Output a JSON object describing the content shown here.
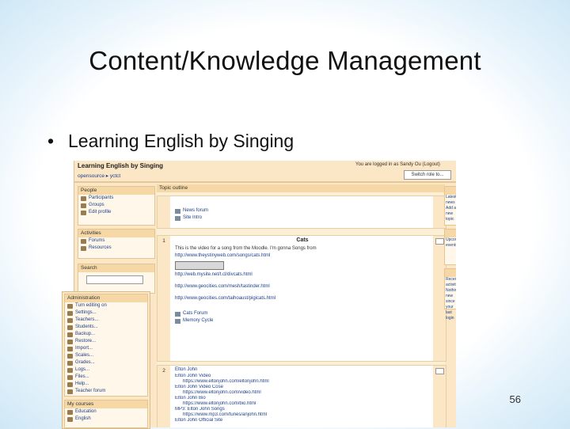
{
  "slide": {
    "title": "Content/Knowledge Management",
    "bullet": "Learning English by Singing",
    "page_number": "56"
  },
  "screenshot": {
    "course_title": "Learning English by Singing",
    "login_info": "You are logged in as Sandy Ou (Logout)",
    "breadcrumb": "opensource ▸ yctct",
    "role_button": "Switch role to...",
    "blocks": {
      "people": {
        "title": "People",
        "items": [
          "Participants",
          "Groups",
          "Edit profile"
        ]
      },
      "activities": {
        "title": "Activities",
        "items": [
          "Forums",
          "Resources"
        ]
      },
      "search": {
        "title": "Search"
      },
      "administration": {
        "title": "Administration",
        "items": [
          "Turn editing on",
          "Settings...",
          "Teachers...",
          "Students...",
          "Backup...",
          "Restore...",
          "Import...",
          "Scales...",
          "Grades...",
          "Logs...",
          "Files...",
          "Help...",
          "Teacher forum"
        ]
      },
      "my_courses": {
        "title": "My courses",
        "items": [
          "Education",
          "English"
        ]
      }
    },
    "center": {
      "header": "Topic outline",
      "top_items": [
        "News forum",
        "Site Intro"
      ],
      "topic1": {
        "number": "1",
        "title": "Cats",
        "lines": [
          "This is the video for a song from the Moodle. I'm gonna Songs from",
          "http://www.theystinyweb.com/songs/cats.html"
        ],
        "links": [
          "http://web.mysite.net/t.cl/divcats.html",
          "http://www.geocities.com/mesh/tastinder.html",
          "http://www.geocities.com/taihoaust/pigicats.html"
        ],
        "resources": [
          "Cats Forum",
          "Memory Cycle"
        ]
      },
      "topic2": {
        "number": "2",
        "lines": [
          "Elton John",
          "Elton John Video",
          "https://www.eltonjohn.com/eltonjohn.html",
          "Elton John Video Cose",
          "https://www.eltonjohn.com/video.html",
          "Elton John Bio",
          "https://www.eltonjohn.com/bio.html",
          "MP3: Elton John Songs",
          "https://www.mp3.com/tunes/anjohn.html",
          "Elton John Official Site"
        ]
      }
    },
    "right": [
      "Latest news",
      "Add a new topic",
      "Upcoming events",
      "Recent activity",
      "Nothing new since your last login"
    ]
  }
}
